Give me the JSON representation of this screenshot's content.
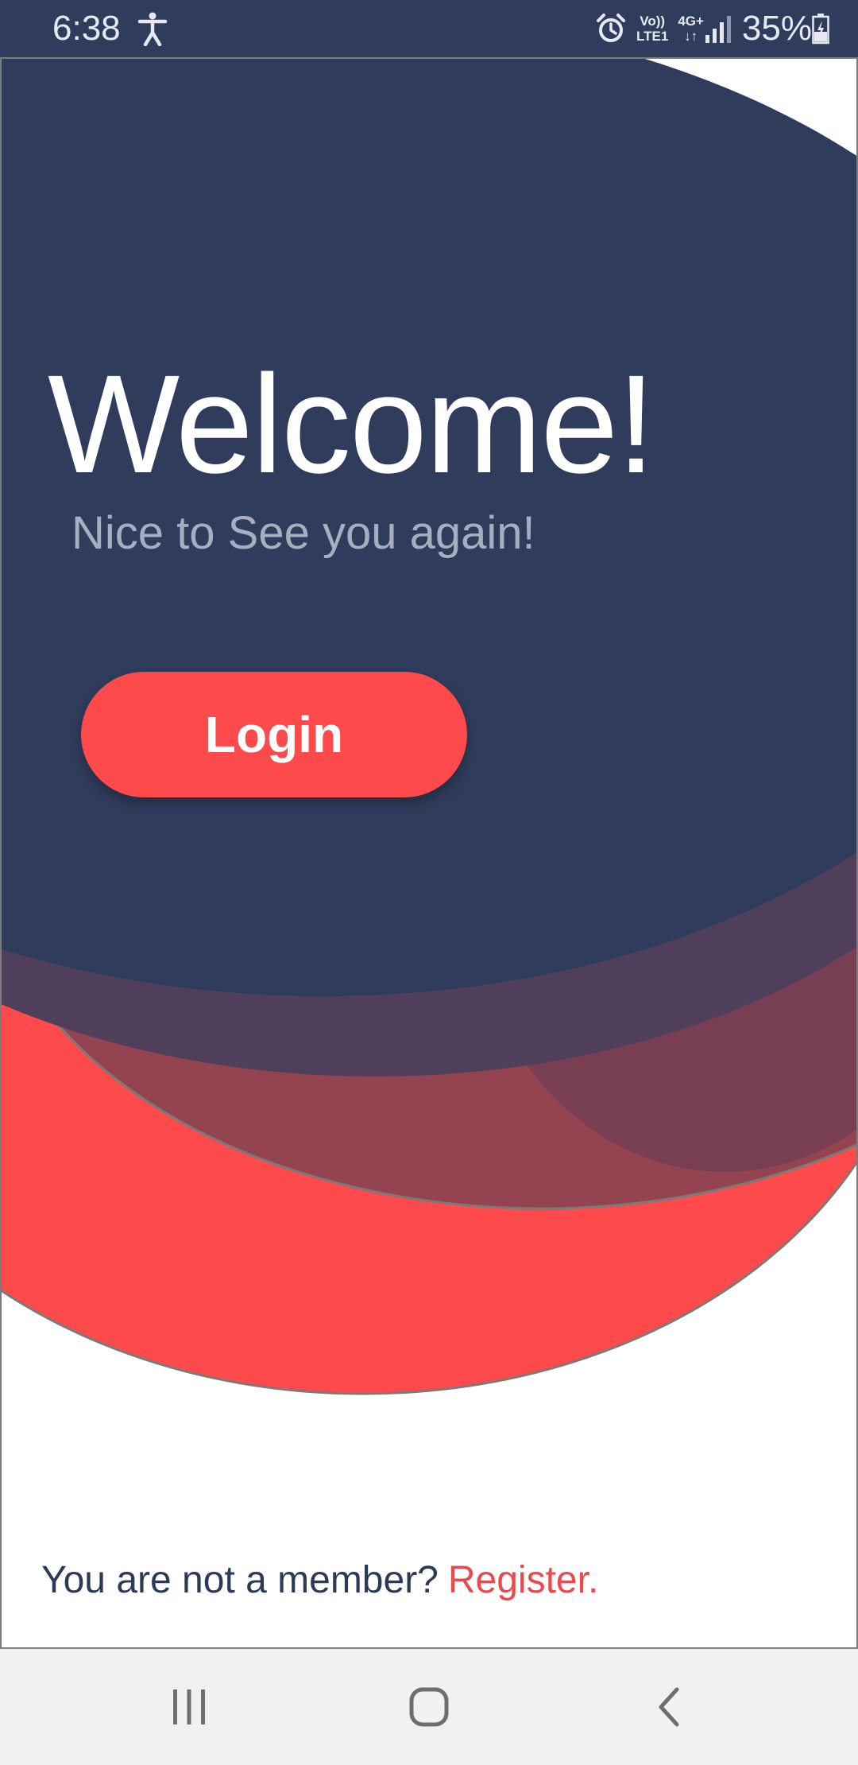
{
  "status_bar": {
    "time": "6:38",
    "volte_top": "Vo))",
    "volte_bottom": "LTE1",
    "network": "4G+",
    "battery_percent": "35%",
    "icons": [
      "accessibility-icon",
      "alarm-icon",
      "volte-icon",
      "network-4g-icon",
      "signal-icon",
      "battery-charging-icon"
    ]
  },
  "main": {
    "title": "Welcome!",
    "subtitle": "Nice to See you again!",
    "login_label": "Login"
  },
  "footer": {
    "prompt": "You are not a member?",
    "register_label": "Register."
  },
  "nav_bar": {
    "icons": [
      "recent-apps-icon",
      "home-icon",
      "back-icon"
    ]
  },
  "colors": {
    "primary_navy": "#2f3c5c",
    "accent_red": "#fe4a4a",
    "subtitle_gray": "#a7aebf",
    "link_red": "#e94a4f",
    "nav_bar_bg": "#f1f1f1"
  }
}
